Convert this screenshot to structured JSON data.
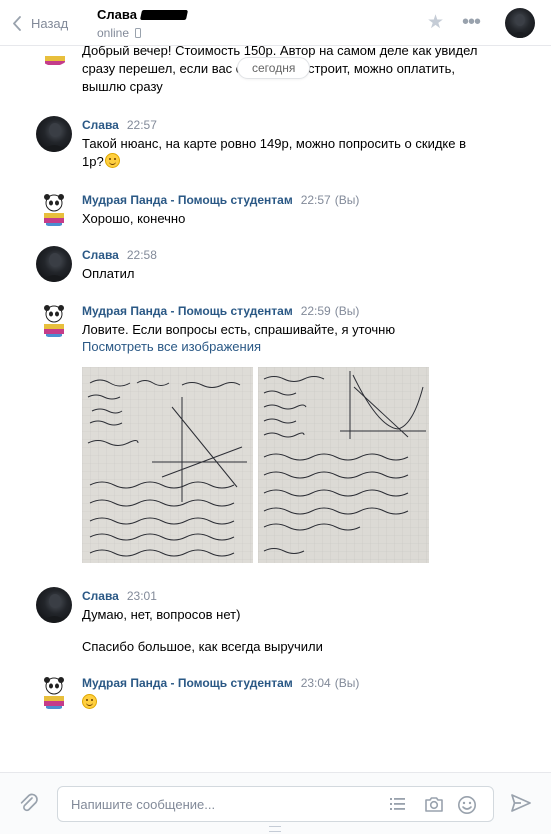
{
  "header": {
    "back_label": "Назад",
    "peer_name": "Слава",
    "peer_status": "online"
  },
  "date_separator": "сегодня",
  "messages": [
    {
      "text": "Добрый вечер! Стоимость 150р. Автор на самом деле как увидел сразу перешел, если вас стоимость устроит, можно оплатить, вышлю сразу"
    },
    {
      "author": "Слава",
      "time": "22:57",
      "text": "Такой нюанс, на карте ровно 149р, можно попросить о скидке в 1р?"
    },
    {
      "author": "Мудрая Панда - Помощь студентам",
      "time": "22:57",
      "you": "(Вы)",
      "text": "Хорошо, конечно"
    },
    {
      "author": "Слава",
      "time": "22:58",
      "text": "Оплатил"
    },
    {
      "author": "Мудрая Панда - Помощь студентам",
      "time": "22:59",
      "you": "(Вы)",
      "text": "Ловите. Если вопросы есть, спрашивайте, я уточню",
      "link": "Посмотреть все изображения"
    },
    {
      "author": "Слава",
      "time": "23:01",
      "text": "Думаю, нет, вопросов нет)",
      "text2": "Спасибо большое, как всегда выручили"
    },
    {
      "author": "Мудрая Панда - Помощь студентам",
      "time": "23:04",
      "you": "(Вы)"
    }
  ],
  "composer": {
    "placeholder": "Напишите сообщение..."
  }
}
